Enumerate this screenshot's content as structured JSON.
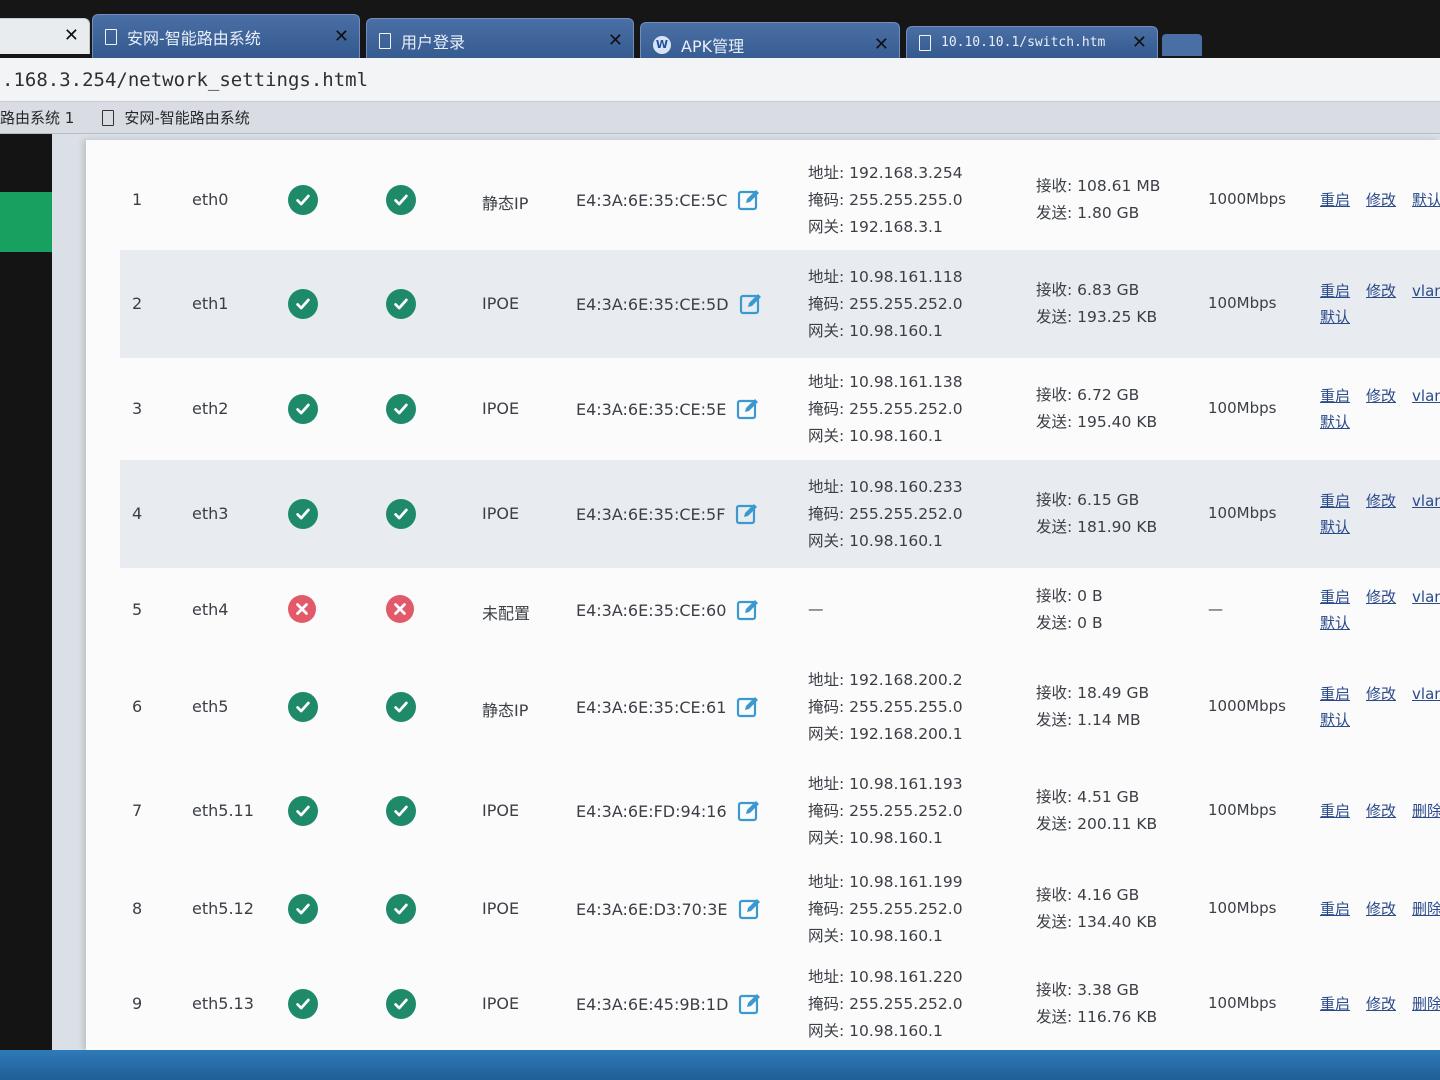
{
  "tabs": [
    {
      "label": "",
      "icon": "none"
    },
    {
      "label": "安网-智能路由系统",
      "icon": "page-icon"
    },
    {
      "label": "用户登录",
      "icon": "page-icon"
    },
    {
      "label": "APK管理",
      "icon": "w-icon"
    },
    {
      "label": "10.10.10.1/switch.htm",
      "icon": "page-icon"
    }
  ],
  "address": {
    "url": ".168.3.254/network_settings.html"
  },
  "bookmarks": [
    {
      "label": "路由系统 1"
    },
    {
      "label": "安网-智能路由系统"
    }
  ],
  "labels": {
    "addr": "地址:",
    "mask": "掩码:",
    "gw": "网关:",
    "rx": "接收:",
    "tx": "发送:",
    "restart": "重启",
    "modify": "修改",
    "default": "默认",
    "vlan": "vlan",
    "delete": "删除"
  },
  "colors": {
    "ok": "#1f8a6a",
    "error": "#e25a6a",
    "link": "#2a4a8a",
    "alt_row": "#e8ecf1"
  },
  "rows": [
    {
      "idx": "1",
      "name": "eth0",
      "s1": "ok",
      "s2": "ok",
      "mode": "静态IP",
      "mac": "E4:3A:6E:35:CE:5C",
      "addr": "192.168.3.254",
      "mask": "255.255.255.0",
      "gw": "192.168.3.1",
      "rx": "108.61 MB",
      "tx": "1.80 GB",
      "speed": "1000Mbps",
      "actions": [
        "重启",
        "修改",
        "默认"
      ]
    },
    {
      "idx": "2",
      "name": "eth1",
      "s1": "ok",
      "s2": "ok",
      "mode": "IPOE",
      "mac": "E4:3A:6E:35:CE:5D",
      "addr": "10.98.161.118",
      "mask": "255.255.252.0",
      "gw": "10.98.160.1",
      "rx": "6.83 GB",
      "tx": "193.25 KB",
      "speed": "100Mbps",
      "actions": [
        "重启",
        "修改",
        "vlan",
        "默认"
      ]
    },
    {
      "idx": "3",
      "name": "eth2",
      "s1": "ok",
      "s2": "ok",
      "mode": "IPOE",
      "mac": "E4:3A:6E:35:CE:5E",
      "addr": "10.98.161.138",
      "mask": "255.255.252.0",
      "gw": "10.98.160.1",
      "rx": "6.72 GB",
      "tx": "195.40 KB",
      "speed": "100Mbps",
      "actions": [
        "重启",
        "修改",
        "vlan",
        "默认"
      ]
    },
    {
      "idx": "4",
      "name": "eth3",
      "s1": "ok",
      "s2": "ok",
      "mode": "IPOE",
      "mac": "E4:3A:6E:35:CE:5F",
      "addr": "10.98.160.233",
      "mask": "255.255.252.0",
      "gw": "10.98.160.1",
      "rx": "6.15 GB",
      "tx": "181.90 KB",
      "speed": "100Mbps",
      "actions": [
        "重启",
        "修改",
        "vlan",
        "默认"
      ]
    },
    {
      "idx": "5",
      "name": "eth4",
      "s1": "error",
      "s2": "error",
      "mode": "未配置",
      "mac": "E4:3A:6E:35:CE:60",
      "addr": "—",
      "mask": "",
      "gw": "",
      "rx": "0 B",
      "tx": "0 B",
      "speed": "—",
      "actions": [
        "重启",
        "修改",
        "vlan",
        "默认"
      ]
    },
    {
      "idx": "6",
      "name": "eth5",
      "s1": "ok",
      "s2": "ok",
      "mode": "静态IP",
      "mac": "E4:3A:6E:35:CE:61",
      "addr": "192.168.200.2",
      "mask": "255.255.255.0",
      "gw": "192.168.200.1",
      "rx": "18.49 GB",
      "tx": "1.14 MB",
      "speed": "1000Mbps",
      "actions": [
        "重启",
        "修改",
        "vlan",
        "默认"
      ]
    },
    {
      "idx": "7",
      "name": "eth5.11",
      "s1": "ok",
      "s2": "ok",
      "mode": "IPOE",
      "mac": "E4:3A:6E:FD:94:16",
      "addr": "10.98.161.193",
      "mask": "255.255.252.0",
      "gw": "10.98.160.1",
      "rx": "4.51 GB",
      "tx": "200.11 KB",
      "speed": "100Mbps",
      "actions": [
        "重启",
        "修改",
        "删除"
      ]
    },
    {
      "idx": "8",
      "name": "eth5.12",
      "s1": "ok",
      "s2": "ok",
      "mode": "IPOE",
      "mac": "E4:3A:6E:D3:70:3E",
      "addr": "10.98.161.199",
      "mask": "255.255.252.0",
      "gw": "10.98.160.1",
      "rx": "4.16 GB",
      "tx": "134.40 KB",
      "speed": "100Mbps",
      "actions": [
        "重启",
        "修改",
        "删除"
      ]
    },
    {
      "idx": "9",
      "name": "eth5.13",
      "s1": "ok",
      "s2": "ok",
      "mode": "IPOE",
      "mac": "E4:3A:6E:45:9B:1D",
      "addr": "10.98.161.220",
      "mask": "255.255.252.0",
      "gw": "10.98.160.1",
      "rx": "3.38 GB",
      "tx": "116.76 KB",
      "speed": "100Mbps",
      "actions": [
        "重启",
        "修改",
        "删除"
      ]
    }
  ]
}
